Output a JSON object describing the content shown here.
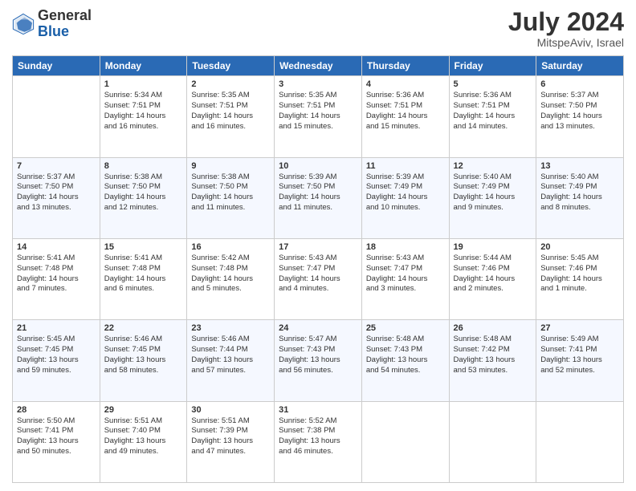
{
  "logo": {
    "general": "General",
    "blue": "Blue"
  },
  "title": "July 2024",
  "location": "MitspeAviv, Israel",
  "days": [
    "Sunday",
    "Monday",
    "Tuesday",
    "Wednesday",
    "Thursday",
    "Friday",
    "Saturday"
  ],
  "weeks": [
    [
      {
        "num": "",
        "text": ""
      },
      {
        "num": "1",
        "text": "Sunrise: 5:34 AM\nSunset: 7:51 PM\nDaylight: 14 hours\nand 16 minutes."
      },
      {
        "num": "2",
        "text": "Sunrise: 5:35 AM\nSunset: 7:51 PM\nDaylight: 14 hours\nand 16 minutes."
      },
      {
        "num": "3",
        "text": "Sunrise: 5:35 AM\nSunset: 7:51 PM\nDaylight: 14 hours\nand 15 minutes."
      },
      {
        "num": "4",
        "text": "Sunrise: 5:36 AM\nSunset: 7:51 PM\nDaylight: 14 hours\nand 15 minutes."
      },
      {
        "num": "5",
        "text": "Sunrise: 5:36 AM\nSunset: 7:51 PM\nDaylight: 14 hours\nand 14 minutes."
      },
      {
        "num": "6",
        "text": "Sunrise: 5:37 AM\nSunset: 7:50 PM\nDaylight: 14 hours\nand 13 minutes."
      }
    ],
    [
      {
        "num": "7",
        "text": "Sunrise: 5:37 AM\nSunset: 7:50 PM\nDaylight: 14 hours\nand 13 minutes."
      },
      {
        "num": "8",
        "text": "Sunrise: 5:38 AM\nSunset: 7:50 PM\nDaylight: 14 hours\nand 12 minutes."
      },
      {
        "num": "9",
        "text": "Sunrise: 5:38 AM\nSunset: 7:50 PM\nDaylight: 14 hours\nand 11 minutes."
      },
      {
        "num": "10",
        "text": "Sunrise: 5:39 AM\nSunset: 7:50 PM\nDaylight: 14 hours\nand 11 minutes."
      },
      {
        "num": "11",
        "text": "Sunrise: 5:39 AM\nSunset: 7:49 PM\nDaylight: 14 hours\nand 10 minutes."
      },
      {
        "num": "12",
        "text": "Sunrise: 5:40 AM\nSunset: 7:49 PM\nDaylight: 14 hours\nand 9 minutes."
      },
      {
        "num": "13",
        "text": "Sunrise: 5:40 AM\nSunset: 7:49 PM\nDaylight: 14 hours\nand 8 minutes."
      }
    ],
    [
      {
        "num": "14",
        "text": "Sunrise: 5:41 AM\nSunset: 7:48 PM\nDaylight: 14 hours\nand 7 minutes."
      },
      {
        "num": "15",
        "text": "Sunrise: 5:41 AM\nSunset: 7:48 PM\nDaylight: 14 hours\nand 6 minutes."
      },
      {
        "num": "16",
        "text": "Sunrise: 5:42 AM\nSunset: 7:48 PM\nDaylight: 14 hours\nand 5 minutes."
      },
      {
        "num": "17",
        "text": "Sunrise: 5:43 AM\nSunset: 7:47 PM\nDaylight: 14 hours\nand 4 minutes."
      },
      {
        "num": "18",
        "text": "Sunrise: 5:43 AM\nSunset: 7:47 PM\nDaylight: 14 hours\nand 3 minutes."
      },
      {
        "num": "19",
        "text": "Sunrise: 5:44 AM\nSunset: 7:46 PM\nDaylight: 14 hours\nand 2 minutes."
      },
      {
        "num": "20",
        "text": "Sunrise: 5:45 AM\nSunset: 7:46 PM\nDaylight: 14 hours\nand 1 minute."
      }
    ],
    [
      {
        "num": "21",
        "text": "Sunrise: 5:45 AM\nSunset: 7:45 PM\nDaylight: 13 hours\nand 59 minutes."
      },
      {
        "num": "22",
        "text": "Sunrise: 5:46 AM\nSunset: 7:45 PM\nDaylight: 13 hours\nand 58 minutes."
      },
      {
        "num": "23",
        "text": "Sunrise: 5:46 AM\nSunset: 7:44 PM\nDaylight: 13 hours\nand 57 minutes."
      },
      {
        "num": "24",
        "text": "Sunrise: 5:47 AM\nSunset: 7:43 PM\nDaylight: 13 hours\nand 56 minutes."
      },
      {
        "num": "25",
        "text": "Sunrise: 5:48 AM\nSunset: 7:43 PM\nDaylight: 13 hours\nand 54 minutes."
      },
      {
        "num": "26",
        "text": "Sunrise: 5:48 AM\nSunset: 7:42 PM\nDaylight: 13 hours\nand 53 minutes."
      },
      {
        "num": "27",
        "text": "Sunrise: 5:49 AM\nSunset: 7:41 PM\nDaylight: 13 hours\nand 52 minutes."
      }
    ],
    [
      {
        "num": "28",
        "text": "Sunrise: 5:50 AM\nSunset: 7:41 PM\nDaylight: 13 hours\nand 50 minutes."
      },
      {
        "num": "29",
        "text": "Sunrise: 5:51 AM\nSunset: 7:40 PM\nDaylight: 13 hours\nand 49 minutes."
      },
      {
        "num": "30",
        "text": "Sunrise: 5:51 AM\nSunset: 7:39 PM\nDaylight: 13 hours\nand 47 minutes."
      },
      {
        "num": "31",
        "text": "Sunrise: 5:52 AM\nSunset: 7:38 PM\nDaylight: 13 hours\nand 46 minutes."
      },
      {
        "num": "",
        "text": ""
      },
      {
        "num": "",
        "text": ""
      },
      {
        "num": "",
        "text": ""
      }
    ]
  ]
}
